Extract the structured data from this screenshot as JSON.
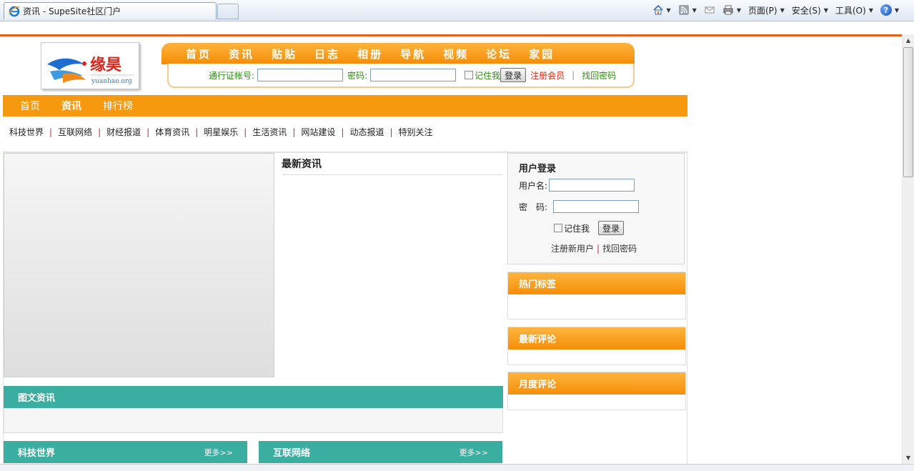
{
  "browser": {
    "tab_title": "资讯 - SupeSite社区门户",
    "commands": {
      "page": "页面(P)",
      "safety": "安全(S)",
      "tools": "工具(O)"
    }
  },
  "header": {
    "logo_text": "缘昊",
    "logo_domain": "yuanhao.org",
    "top_nav": [
      "首页",
      "资讯",
      "贴贴",
      "日志",
      "相册",
      "导航",
      "视频",
      "论坛",
      "家园"
    ],
    "login": {
      "account_label": "通行证帐号:",
      "password_label": "密码:",
      "remember_label": "记住我",
      "login_button": "登录",
      "register_link": "注册会员",
      "separator": "|",
      "recover_link": "找回密码"
    }
  },
  "main_nav": {
    "items": [
      {
        "label": "首页",
        "active": false
      },
      {
        "label": "资讯",
        "active": true
      },
      {
        "label": "排行榜",
        "active": false
      }
    ]
  },
  "categories": [
    "科技世界",
    "互联网络",
    "财经报道",
    "体育资讯",
    "明星娱乐",
    "生活资讯",
    "网站建设",
    "动态报道",
    "特别关注"
  ],
  "content": {
    "latest_news_title": "最新资讯",
    "pic_news_title": "图文资讯",
    "section_left": {
      "title": "科技世界",
      "more": "更多>>"
    },
    "section_right": {
      "title": "互联网络",
      "more": "更多>>"
    }
  },
  "sidebar": {
    "login_panel": {
      "title": "用户登录",
      "username_label": "用户名:",
      "password_label": "密　码:",
      "remember_label": "记住我",
      "login_button": "登录",
      "register_link": "注册新用户",
      "separator": "|",
      "recover_link": "找回密码"
    },
    "hot_tags_title": "热门标签",
    "latest_comments_title": "最新评论",
    "monthly_comments_title": "月度评论"
  }
}
